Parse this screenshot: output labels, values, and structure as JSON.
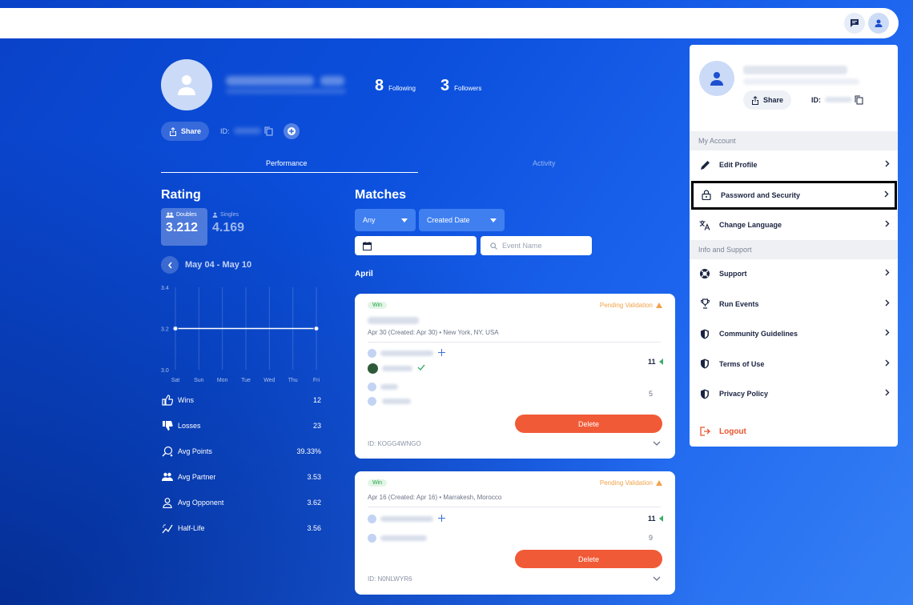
{
  "profile": {
    "id_label": "ID:",
    "share_label": "Share",
    "following_count": "8",
    "following_label": "Following",
    "followers_count": "3",
    "followers_label": "Followers"
  },
  "tabs": [
    "Performance",
    "Activity"
  ],
  "rating": {
    "title": "Rating",
    "doubles_label": "Doubles",
    "doubles_value": "3.212",
    "singles_label": "Singles",
    "singles_value": "4.169",
    "week_range": "May 04 - May 10"
  },
  "chart_data": {
    "type": "line",
    "categories": [
      "Sat",
      "Sun",
      "Mon",
      "Tue",
      "Wed",
      "Thu",
      "Fri"
    ],
    "series": [
      {
        "values": [
          3.2,
          null,
          null,
          null,
          null,
          null,
          3.2
        ]
      }
    ],
    "ylim": [
      3.0,
      3.4
    ],
    "yticks": [
      "3.4",
      "3.2",
      "3.0"
    ],
    "grid": true
  },
  "metrics": [
    {
      "icon": "thumbs-up-icon",
      "label": "Wins",
      "value": "12"
    },
    {
      "icon": "thumbs-down-icon",
      "label": "Losses",
      "value": "23"
    },
    {
      "icon": "points-icon",
      "label": "Avg Points",
      "value": "39.33%"
    },
    {
      "icon": "partner-icon",
      "label": "Avg Partner",
      "value": "3.53"
    },
    {
      "icon": "opponent-icon",
      "label": "Avg Opponent",
      "value": "3.62"
    },
    {
      "icon": "half-life-icon",
      "label": "Half-Life",
      "value": "3.56"
    }
  ],
  "matches": {
    "title": "Matches",
    "filter_any": "Any",
    "filter_sort": "Created Date",
    "event_placeholder": "Event Name",
    "month": "April",
    "cards": [
      {
        "badge": "Win",
        "status": "Pending Validation",
        "meta": "Apr 30 (Created: Apr 30) • New York, NY, USA",
        "score_a": "11",
        "score_b": "5",
        "delete_label": "Delete",
        "id": "ID: KOGG4WNGO"
      },
      {
        "badge": "Win",
        "status": "Pending Validation",
        "meta": "Apr 16 (Created: Apr 16) • Marrakesh, Morocco",
        "score_a": "11",
        "score_b": "9",
        "delete_label": "Delete",
        "id": "ID: N0NLWYR6"
      }
    ]
  },
  "panel": {
    "share_label": "Share",
    "id_label": "ID:",
    "section_account": "My Account",
    "section_support": "Info and Support",
    "items_account": [
      {
        "icon": "pencil-icon",
        "label": "Edit Profile"
      },
      {
        "icon": "lock-icon",
        "label": "Password and Security"
      },
      {
        "icon": "translate-icon",
        "label": "Change Language"
      }
    ],
    "items_support": [
      {
        "icon": "lifebuoy-icon",
        "label": "Support"
      },
      {
        "icon": "trophy-icon",
        "label": "Run Events"
      },
      {
        "icon": "shield-icon",
        "label": "Community Guidelines"
      },
      {
        "icon": "shield-icon",
        "label": "Terms of Use"
      },
      {
        "icon": "shield-icon",
        "label": "Privacy Policy"
      }
    ],
    "logout_label": "Logout"
  },
  "colors": {
    "accent_delete": "#f15a37",
    "win_green": "#26a346",
    "pending_orange": "#f0a34a"
  }
}
